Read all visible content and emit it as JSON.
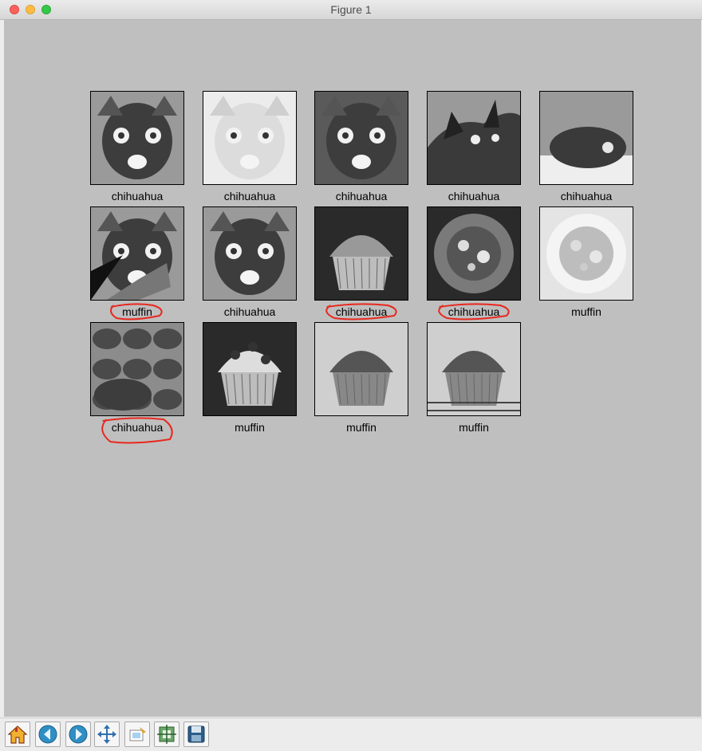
{
  "window": {
    "title": "Figure 1"
  },
  "figure": {
    "background": "#bfbfbf",
    "annotation_color": "#e8281e",
    "images": [
      {
        "label": "chihuahua",
        "kind": "dog",
        "circled": false
      },
      {
        "label": "chihuahua",
        "kind": "dog-light",
        "circled": false
      },
      {
        "label": "chihuahua",
        "kind": "dog-dark",
        "circled": false
      },
      {
        "label": "chihuahua",
        "kind": "cat",
        "circled": false
      },
      {
        "label": "chihuahua",
        "kind": "dog-lying",
        "circled": false
      },
      {
        "label": "muffin",
        "kind": "dog-bite",
        "circled": true
      },
      {
        "label": "chihuahua",
        "kind": "dog-ears",
        "circled": false
      },
      {
        "label": "chihuahua",
        "kind": "muffin-dark",
        "circled": true
      },
      {
        "label": "chihuahua",
        "kind": "muffin-top",
        "circled": true
      },
      {
        "label": "muffin",
        "kind": "muffin-top-light",
        "circled": false
      },
      {
        "label": "chihuahua",
        "kind": "muffin-tray",
        "circled": true
      },
      {
        "label": "muffin",
        "kind": "muffin-choc",
        "circled": false
      },
      {
        "label": "muffin",
        "kind": "muffin-plain",
        "circled": false
      },
      {
        "label": "muffin",
        "kind": "muffin-rack",
        "circled": false
      }
    ]
  },
  "toolbar": {
    "buttons": [
      {
        "name": "home-button",
        "icon": "home-icon"
      },
      {
        "name": "back-button",
        "icon": "arrow-left-icon"
      },
      {
        "name": "forward-button",
        "icon": "arrow-right-icon"
      },
      {
        "name": "pan-button",
        "icon": "move-icon"
      },
      {
        "name": "zoom-button",
        "icon": "zoom-rect-icon"
      },
      {
        "name": "subplots-button",
        "icon": "subplots-icon"
      },
      {
        "name": "save-button",
        "icon": "floppy-disk-icon"
      }
    ]
  }
}
